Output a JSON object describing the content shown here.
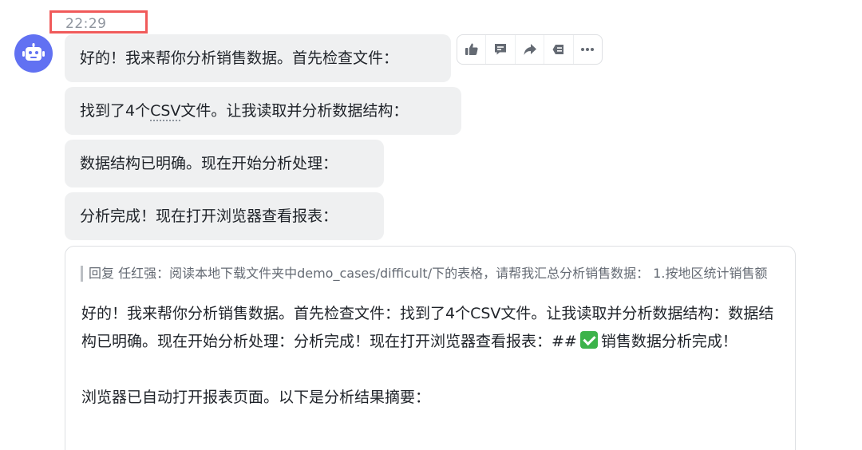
{
  "timestamp": "22:29",
  "messages": [
    {
      "text": "好的！我来帮你分析销售数据。首先检查文件："
    },
    {
      "pre": "找到了4个",
      "csv": "CSV",
      "post": "文件。让我读取并分析数据结构："
    },
    {
      "text": "数据结构已明确。现在开始分析处理："
    },
    {
      "text": "分析完成！现在打开浏览器查看报表："
    }
  ],
  "toolbar": {
    "icons": [
      "thumbs-up-icon",
      "comment-icon",
      "forward-icon",
      "quote-icon",
      "more-icon"
    ]
  },
  "reply_card": {
    "quote": "回复 任红强：阅读本地下载文件夹中demo_cases/difficult/下的表格，请帮我汇总分析销售数据： 1.按地区统计销售额",
    "paragraph1_before": "好的！我来帮你分析销售数据。首先检查文件：找到了4个CSV文件。让我读取并分析数据结构：数据结构已明确。现在开始分析处理：分析完成！现在打开浏览器查看报表：##",
    "check_emoji": "✅",
    "paragraph1_after": "销售数据分析完成！",
    "paragraph2": "浏览器已自动打开报表页面。以下是分析结果摘要："
  },
  "colors": {
    "avatar": "#6171f2",
    "bubble": "#eff0f1",
    "highlight_box": "#f05a5a",
    "check": "#3cb34a"
  }
}
